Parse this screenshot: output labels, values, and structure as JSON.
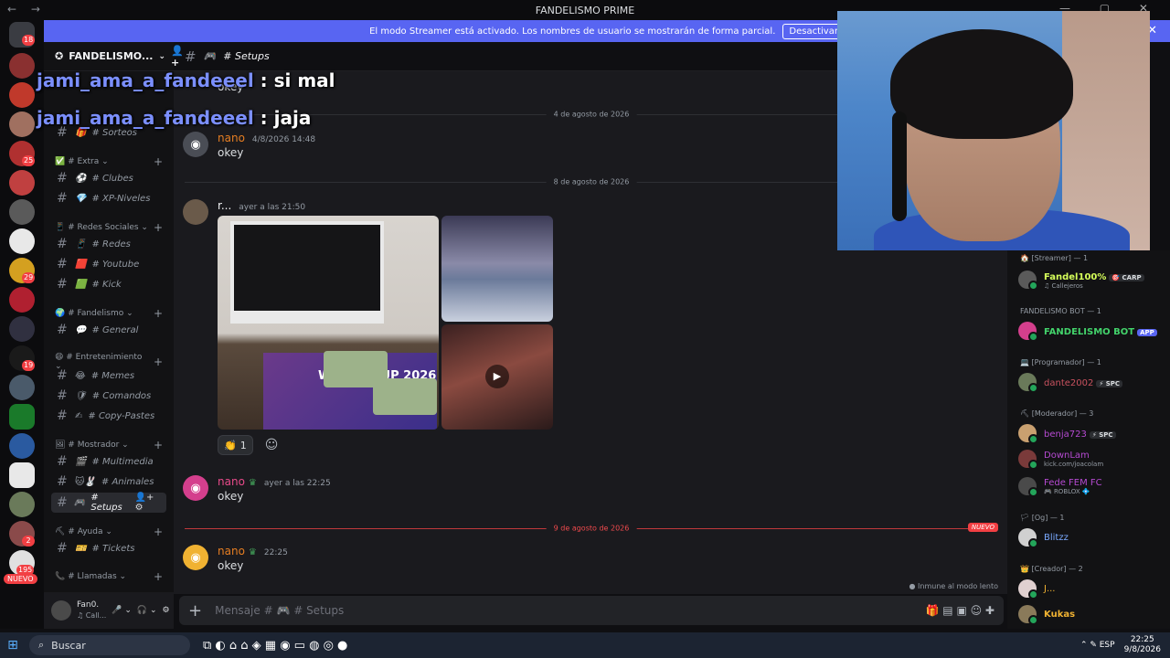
{
  "window": {
    "title": "FANDELISMO PRIME",
    "nav": "← →",
    "controls": "— ▢ ✕"
  },
  "streamer_mode": {
    "text": "El modo Streamer está activado. Los nombres de usuario se mostrarán de forma parcial.",
    "button": "Desactivar",
    "close": "✕"
  },
  "guilds": {
    "badges": [
      "18",
      "25",
      "29",
      "19",
      "2",
      "195"
    ],
    "new": "NUEVO"
  },
  "server": {
    "name": "FANDELISMO PRIME",
    "name_short": "FANDELISMO...",
    "caret": "⌄",
    "invite": "👤+"
  },
  "sidebar": {
    "categories": [
      {
        "label": "✅ # Extra ⌄",
        "plus": "+"
      },
      {
        "label": "📱 # Redes Sociales ⌄",
        "plus": "+"
      },
      {
        "label": "🌍 # Fandelismo ⌄",
        "plus": "+"
      },
      {
        "label": "😄 # Entretenimiento ⌄",
        "plus": "+"
      },
      {
        "label": "🖼 # Mostrador ⌄",
        "plus": "+"
      },
      {
        "label": "⛏ # Ayuda ⌄",
        "plus": "+"
      },
      {
        "label": "📞 # Llamadas ⌄",
        "plus": "+"
      }
    ],
    "channels": [
      {
        "icon": "🎁",
        "label": "# Sorteos"
      },
      {
        "icon": "⚽",
        "label": "# Clubes"
      },
      {
        "icon": "💎",
        "label": "# XP-Niveles"
      },
      {
        "icon": "📱",
        "label": "# Redes"
      },
      {
        "icon": "🟥",
        "label": "# Youtube"
      },
      {
        "icon": "🟩",
        "label": "# Kick"
      },
      {
        "icon": "💬",
        "label": "# General"
      },
      {
        "icon": "😂",
        "label": "# Memes"
      },
      {
        "icon": "🛡",
        "label": "# Comandos"
      },
      {
        "icon": "✍",
        "label": "# Copy-Pastes"
      },
      {
        "icon": "🎬",
        "label": "# Multimedia"
      },
      {
        "icon": "🐱🐰",
        "label": "# Animales"
      },
      {
        "icon": "🎮",
        "label": "# Setups"
      },
      {
        "icon": "🎫",
        "label": "# Tickets"
      }
    ],
    "hash": "#",
    "active_icons": "👤+ ⚙"
  },
  "user_panel": {
    "name": "Fan0.",
    "status": "♫ Call...",
    "mic": "🎤 ⌄",
    "headset": "🎧 ⌄",
    "settings": "⚙"
  },
  "overlay": [
    {
      "user": "jami_ama_a_fandeeel",
      "text": " : si mal"
    },
    {
      "user": "jami_ama_a_fandeeel",
      "text": " : jaja"
    }
  ],
  "channel_header": {
    "hash": "#",
    "icon": "🎮",
    "name": "# Setups"
  },
  "chat": {
    "partial_message": "okey",
    "dividers": [
      "4 de agosto de 2026",
      "8 de agosto de 2026",
      "9 de agosto de 2026"
    ],
    "new_label": "NUEVO",
    "messages": [
      {
        "author": "nano",
        "time": "4/8/2026 14:48",
        "text": "okey"
      },
      {
        "author": "r...",
        "time": "ayer a las 21:50",
        "text": ""
      },
      {
        "author": "nano",
        "time": "ayer a las 22:25",
        "text": "okey"
      },
      {
        "author": "nano",
        "time": "22:25",
        "text": "okey"
      }
    ],
    "image_caption": "WORLD CUP 2026",
    "reaction": {
      "emoji": "👏",
      "count": "1"
    },
    "add_reaction": "☺",
    "slowmode": "● Inmune al modo lento"
  },
  "composer": {
    "plus": "+",
    "placeholder": "Mensaje # 🎮 # Setups",
    "tools": "🎁 ▤ ▣ ☺ ✚"
  },
  "members": {
    "groups": [
      {
        "label": "🏠 [Streamer] — 1",
        "members": [
          {
            "name": "Fandel100%",
            "tag": "🎯 CARP",
            "sub": "♫ Callejeros",
            "color": "#d6ff5a"
          }
        ]
      },
      {
        "label": "FANDELISMO BOT — 1",
        "members": [
          {
            "name": "FANDELISMO BOT",
            "tag": "APP",
            "sub": "",
            "color": "#43d36b"
          }
        ]
      },
      {
        "label": "💻 [Programador] — 1",
        "members": [
          {
            "name": "dante2002",
            "tag": "⚡ SPC",
            "sub": "",
            "color": "#c9525f"
          }
        ]
      },
      {
        "label": "⛏ [Moderador] — 3",
        "members": [
          {
            "name": "benja723",
            "tag": "⚡ SPC",
            "sub": "",
            "color": "#b54ad1"
          },
          {
            "name": "DownLam",
            "tag": "",
            "sub": "kick.com/joacolam",
            "color": "#b54ad1"
          },
          {
            "name": "Fede FEM FC",
            "tag": "",
            "sub": "🎮 ROBLOX 💠",
            "color": "#b54ad1"
          }
        ]
      },
      {
        "label": "🏳 [Og] — 1",
        "members": [
          {
            "name": "Blitzz",
            "tag": "",
            "sub": "",
            "color": "#7aa9ff"
          }
        ]
      },
      {
        "label": "👑 [Creador] — 2",
        "members": [
          {
            "name": "J...",
            "tag": "",
            "sub": "",
            "color": "#f0b232"
          },
          {
            "name": "Kukas",
            "tag": "",
            "sub": "",
            "color": "#f0b232"
          }
        ]
      }
    ]
  },
  "taskbar": {
    "start": "⊞",
    "search": "Buscar",
    "search_icon": "⌕",
    "apps": "⧉ ◐ ⌂ ⌂ ◈ ▦ ◉ ▭ ◍ ◎ ●",
    "tray": "⌃ ✎ ESP",
    "time": "22:25",
    "date": "9/8/2026"
  }
}
